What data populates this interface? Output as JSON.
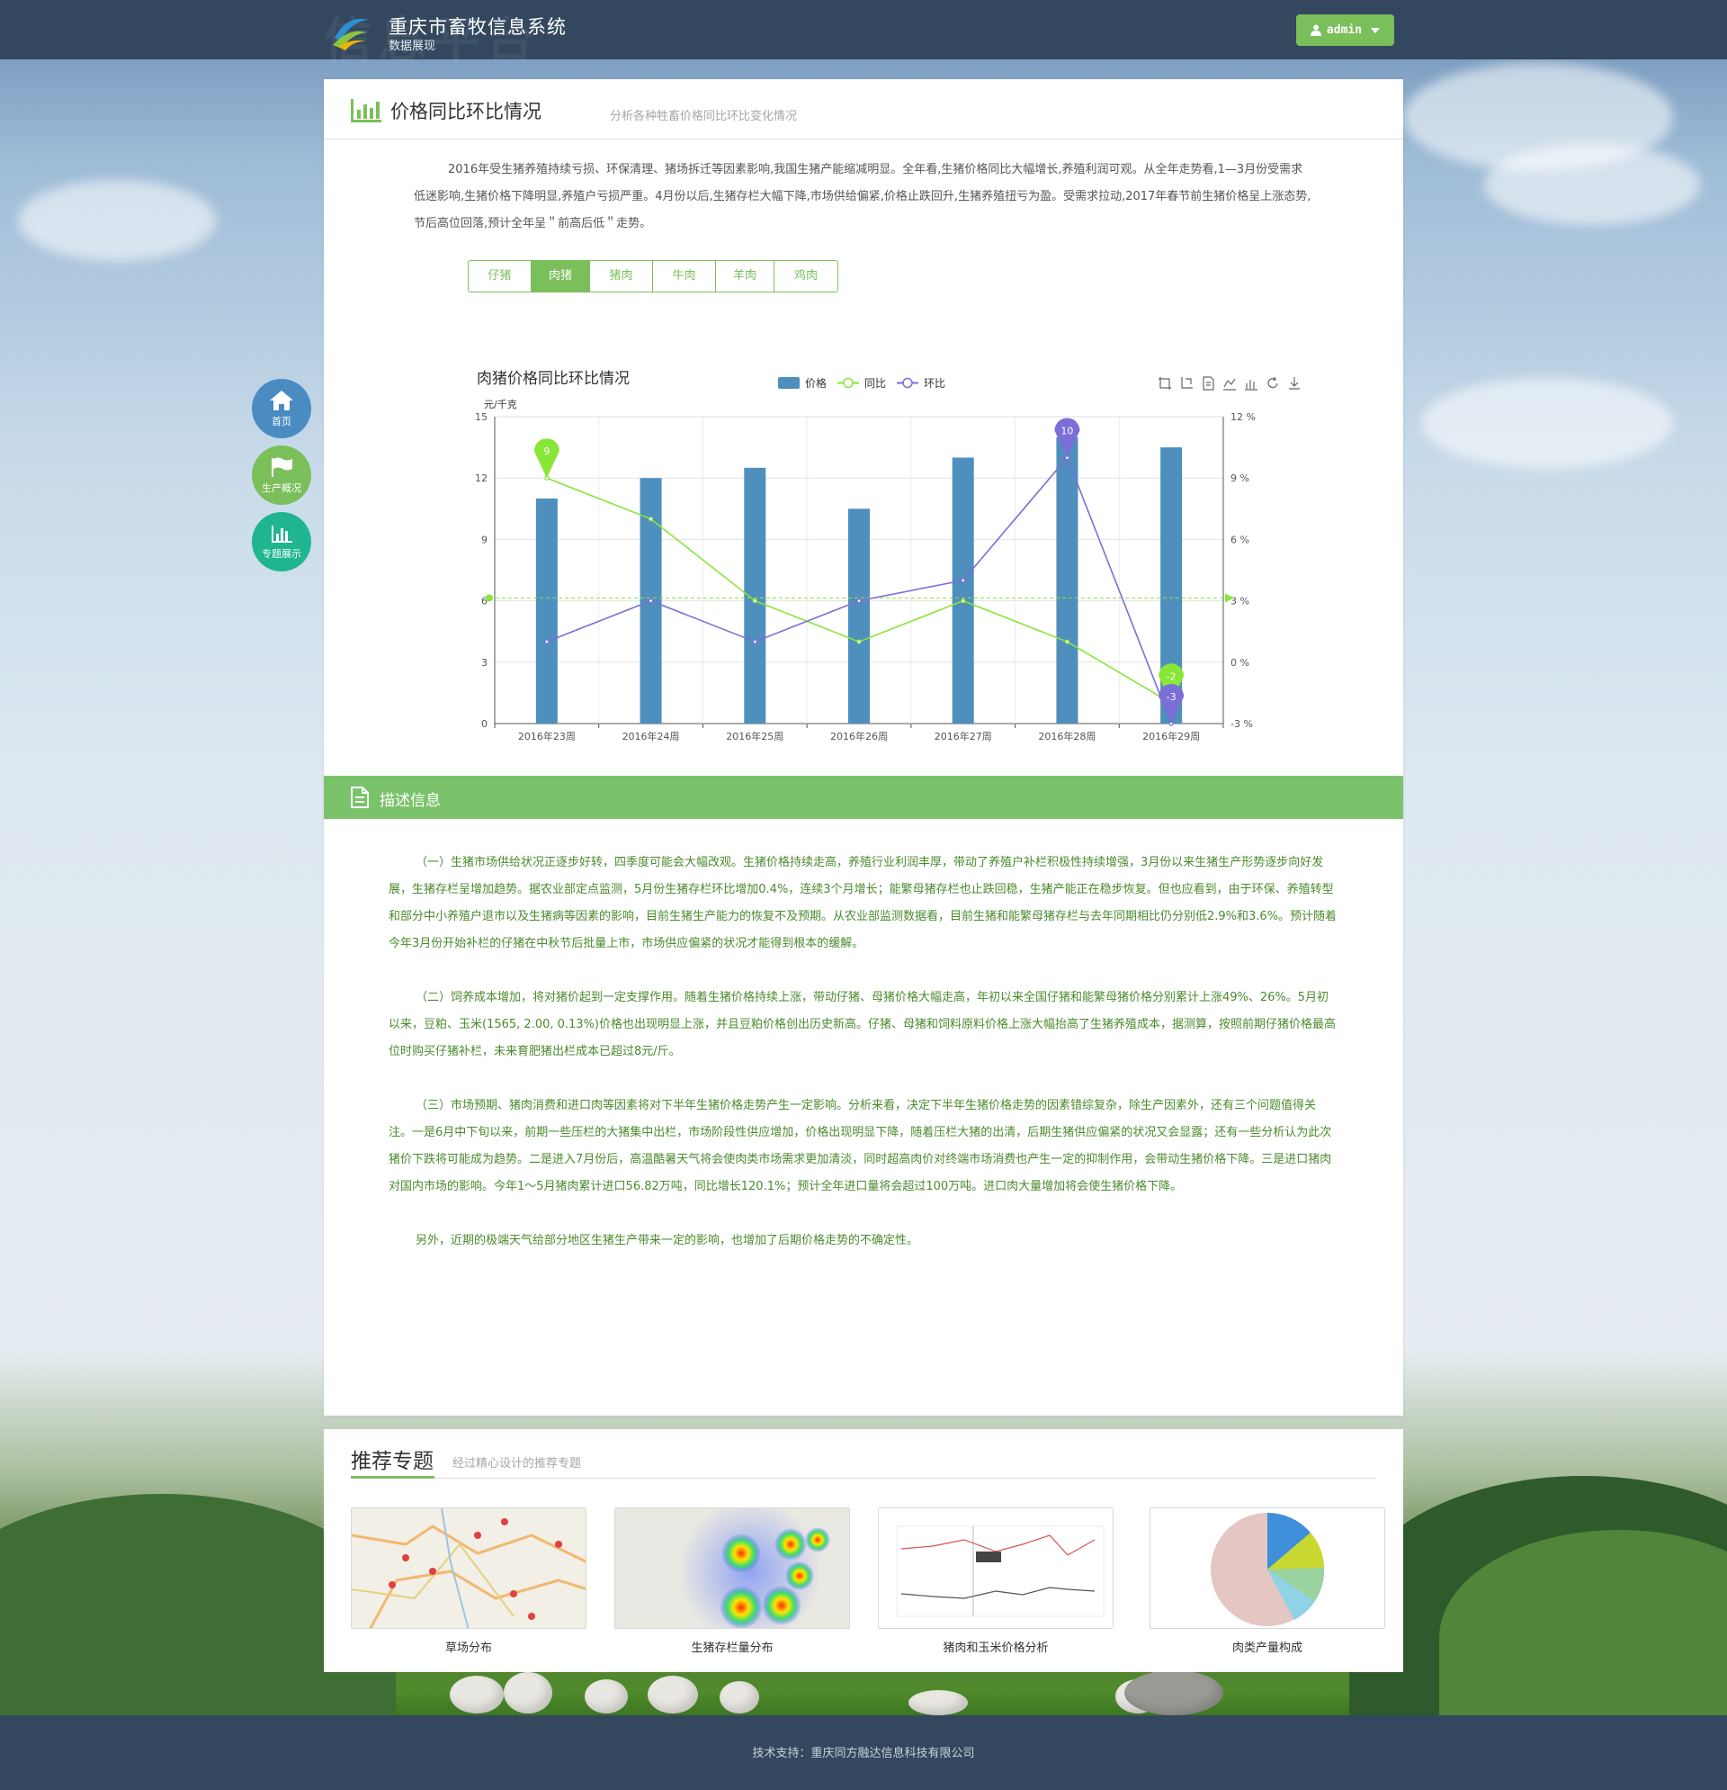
{
  "header": {
    "title": "重庆市畜牧信息系统",
    "subtitle": "数据展现",
    "watermark": "信息平台",
    "user_label": "admin"
  },
  "float_nav": [
    {
      "label": "首页",
      "icon": "home-icon",
      "color": "#4a8bc2"
    },
    {
      "label": "生产概况",
      "icon": "flag-icon",
      "color": "#7bbf5b"
    },
    {
      "label": "专题展示",
      "icon": "bar-chart-icon",
      "color": "#1fb58f"
    }
  ],
  "panel": {
    "title": "价格同比环比情况",
    "subtitle": "分析各种牲畜价格同比环比变化情况",
    "intro": "2016年受生猪养殖持续亏损、环保清理、猪场拆迁等因素影响,我国生猪产能缩减明显。全年看,生猪价格同比大幅增长,养殖利润可观。从全年走势看,1—3月份受需求低迷影响,生猪价格下降明显,养殖户亏损严重。4月份以后,生猪存栏大幅下降,市场供给偏紧,价格止跌回升,生猪养殖扭亏为盈。受需求拉动,2017年春节前生猪价格呈上涨态势,节后高位回落,预计全年呈＂前高后低＂走势。"
  },
  "tabs": [
    {
      "label": "仔猪",
      "active": false
    },
    {
      "label": "肉猪",
      "active": true
    },
    {
      "label": "猪肉",
      "active": false
    },
    {
      "label": "牛肉",
      "active": false
    },
    {
      "label": "羊肉",
      "active": false
    },
    {
      "label": "鸡肉",
      "active": false
    }
  ],
  "chart_data": {
    "type": "bar",
    "title": "肉猪价格同比环比情况",
    "ylabel": "元/千克",
    "categories": [
      "2016年23周",
      "2016年24周",
      "2016年25周",
      "2016年26周",
      "2016年27周",
      "2016年28周",
      "2016年29周"
    ],
    "ylim": [
      0,
      15
    ],
    "yticks": [
      0,
      3,
      6,
      9,
      12,
      15
    ],
    "y2lim": [
      -3,
      12
    ],
    "y2ticks": [
      "-3 %",
      "0 %",
      "3 %",
      "6 %",
      "9 %",
      "12 %"
    ],
    "series": [
      {
        "name": "价格",
        "type": "bar",
        "axis": "left",
        "color": "#4f8fbd",
        "values": [
          11,
          12,
          12.5,
          10.5,
          13,
          14,
          13.5
        ]
      },
      {
        "name": "同比",
        "type": "line",
        "axis": "right",
        "color": "#88e637",
        "values": [
          9,
          7,
          3,
          1,
          3,
          1,
          -2
        ]
      },
      {
        "name": "环比",
        "type": "line",
        "axis": "right",
        "color": "#7a6fd6",
        "values": [
          1,
          3,
          1,
          3,
          4,
          10,
          -3
        ]
      }
    ],
    "markpoints": [
      {
        "series": "同比",
        "label": "9",
        "index": 0
      },
      {
        "series": "同比",
        "label": "-2",
        "index": 6
      },
      {
        "series": "环比",
        "label": "10",
        "index": 5
      },
      {
        "series": "环比",
        "label": "-3",
        "index": 6
      }
    ],
    "markline": {
      "series": "同比",
      "value": 3.14
    },
    "grid": true,
    "legend": "top-center"
  },
  "toolbox_icons": [
    "data-zoom-icon",
    "zoom-reset-icon",
    "data-view-icon",
    "line-type-icon",
    "bar-type-icon",
    "restore-icon",
    "save-image-icon"
  ],
  "description": {
    "title": "描述信息",
    "paragraphs": [
      "（一）生猪市场供给状况正逐步好转，四季度可能会大幅改观。生猪价格持续走高，养殖行业利润丰厚，带动了养殖户补栏积极性持续增强，3月份以来生猪生产形势逐步向好发展，生猪存栏呈增加趋势。据农业部定点监测，5月份生猪存栏环比增加0.4%，连续3个月增长；能繁母猪存栏也止跌回稳，生猪产能正在稳步恢复。但也应看到，由于环保、养殖转型和部分中小养殖户退市以及生猪病等因素的影响，目前生猪生产能力的恢复不及预期。从农业部监测数据看，目前生猪和能繁母猪存栏与去年同期相比仍分别低2.9%和3.6%。预计随着今年3月份开始补栏的仔猪在中秋节后批量上市，市场供应偏紧的状况才能得到根本的缓解。",
      "（二）饲养成本增加，将对猪价起到一定支撑作用。随着生猪价格持续上涨，带动仔猪、母猪价格大幅走高，年初以来全国仔猪和能繁母猪价格分别累计上涨49%、26%。5月初以来，豆粕、玉米(1565, 2.00, 0.13%)价格也出现明显上涨，并且豆粕价格创出历史新高。仔猪、母猪和饲料原料价格上涨大幅抬高了生猪养殖成本，据测算，按照前期仔猪价格最高位时购买仔猪补栏，未来育肥猪出栏成本已超过8元/斤。",
      "（三）市场预期、猪肉消费和进口肉等因素将对下半年生猪价格走势产生一定影响。分析来看，决定下半年生猪价格走势的因素错综复杂，除生产因素外，还有三个问题值得关注。一是6月中下旬以来，前期一些压栏的大猪集中出栏，市场阶段性供应增加，价格出现明显下降，随着压栏大猪的出清，后期生猪供应偏紧的状况又会显露；还有一些分析认为此次猪价下跌将可能成为趋势。二是进入7月份后，高温酷暑天气将会使肉类市场需求更加清淡，同时超高肉价对终端市场消费也产生一定的抑制作用，会带动生猪价格下降。三是进口猪肉对国内市场的影响。今年1～5月猪肉累计进口56.82万吨，同比增长120.1%；预计全年进口量将会超过100万吨。进口肉大量增加将会使生猪价格下降。",
      "另外，近期的极端天气给部分地区生猪生产带来一定的影响，也增加了后期价格走势的不确定性。"
    ]
  },
  "recommend": {
    "title": "推荐专题",
    "subtitle": "经过精心设计的推荐专题",
    "items": [
      {
        "label": "草场分布",
        "thumb": "map-thumbnail"
      },
      {
        "label": "生猪存栏量分布",
        "thumb": "heatmap-thumbnail"
      },
      {
        "label": "猪肉和玉米价格分析",
        "thumb": "line-chart-thumbnail"
      },
      {
        "label": "肉类产量构成",
        "thumb": "pie-chart-thumbnail"
      }
    ]
  },
  "footer": {
    "text": "技术支持：重庆同方融达信息科技有限公司"
  }
}
